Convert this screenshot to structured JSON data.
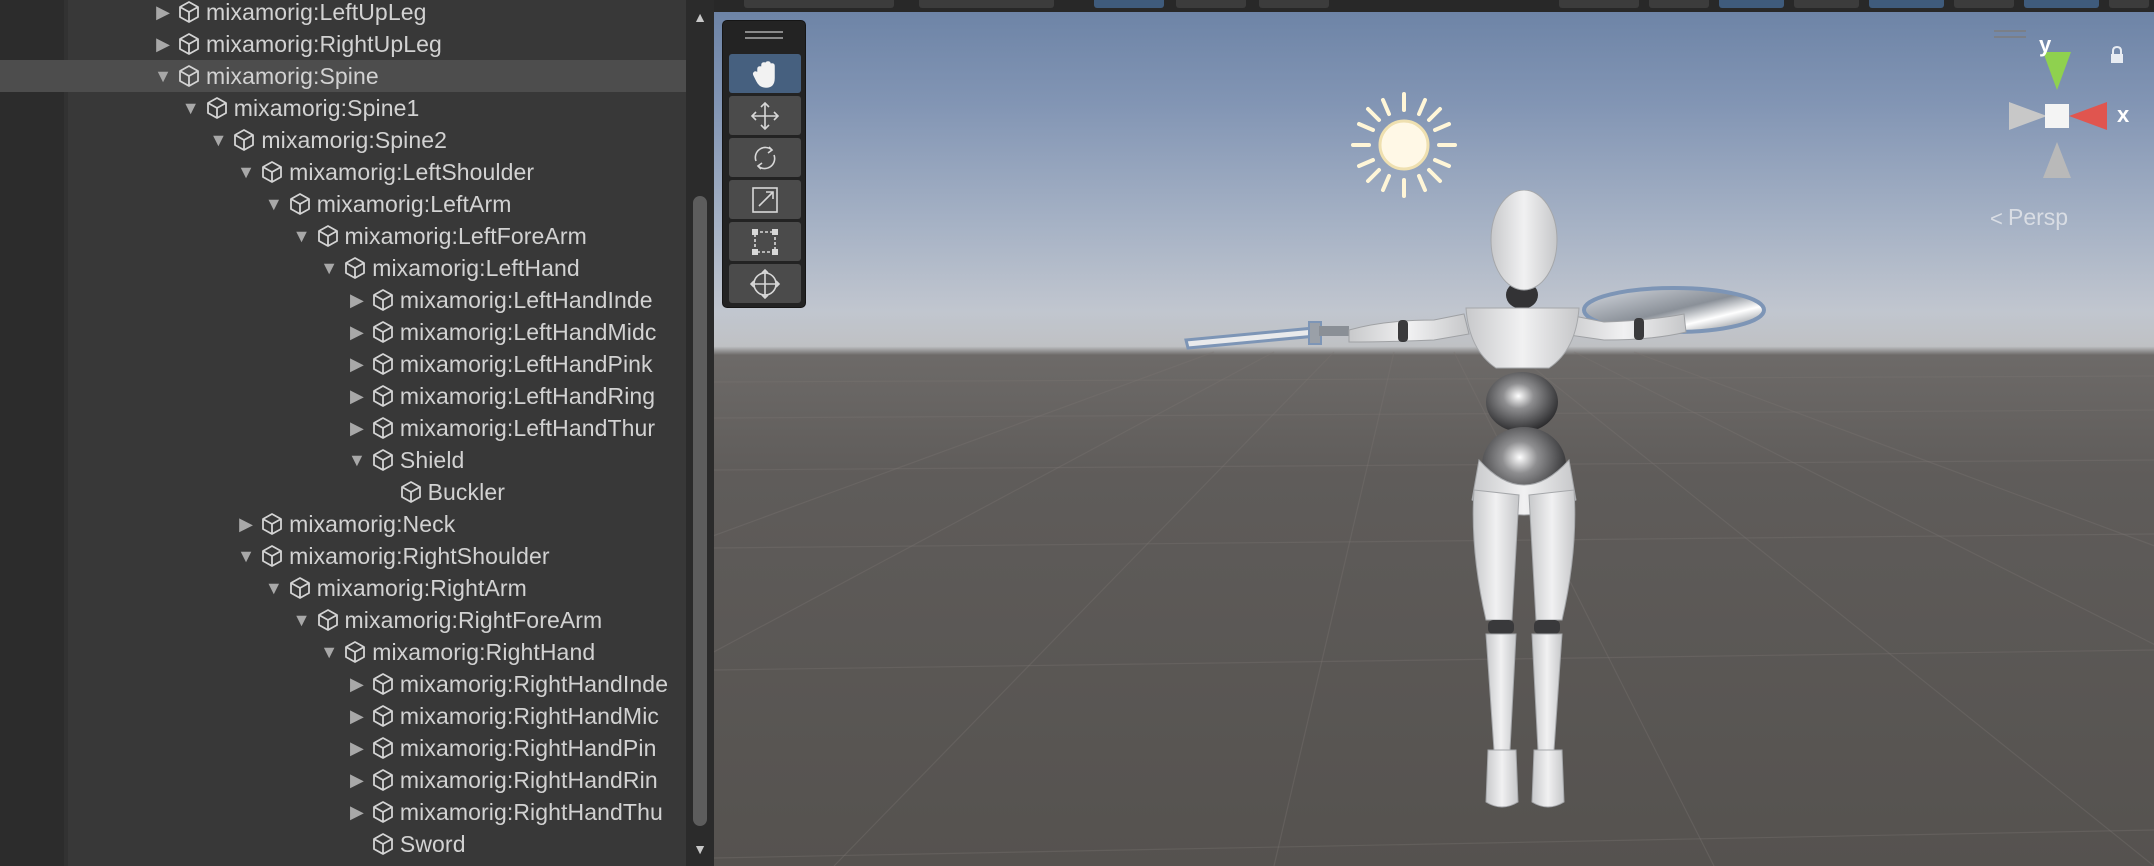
{
  "hierarchy": {
    "items": [
      {
        "label": "mixamorig:LeftUpLeg",
        "depth": 0,
        "arrow": "collapsed",
        "selected": false
      },
      {
        "label": "mixamorig:RightUpLeg",
        "depth": 0,
        "arrow": "collapsed",
        "selected": false
      },
      {
        "label": "mixamorig:Spine",
        "depth": 0,
        "arrow": "expanded",
        "selected": true
      },
      {
        "label": "mixamorig:Spine1",
        "depth": 1,
        "arrow": "expanded",
        "selected": false
      },
      {
        "label": "mixamorig:Spine2",
        "depth": 2,
        "arrow": "expanded",
        "selected": false
      },
      {
        "label": "mixamorig:LeftShoulder",
        "depth": 3,
        "arrow": "expanded",
        "selected": false
      },
      {
        "label": "mixamorig:LeftArm",
        "depth": 4,
        "arrow": "expanded",
        "selected": false
      },
      {
        "label": "mixamorig:LeftForeArm",
        "depth": 5,
        "arrow": "expanded",
        "selected": false
      },
      {
        "label": "mixamorig:LeftHand",
        "depth": 6,
        "arrow": "expanded",
        "selected": false
      },
      {
        "label": "mixamorig:LeftHandInde",
        "depth": 7,
        "arrow": "collapsed",
        "selected": false
      },
      {
        "label": "mixamorig:LeftHandMidc",
        "depth": 7,
        "arrow": "collapsed",
        "selected": false
      },
      {
        "label": "mixamorig:LeftHandPink",
        "depth": 7,
        "arrow": "collapsed",
        "selected": false
      },
      {
        "label": "mixamorig:LeftHandRing",
        "depth": 7,
        "arrow": "collapsed",
        "selected": false
      },
      {
        "label": "mixamorig:LeftHandThur",
        "depth": 7,
        "arrow": "collapsed",
        "selected": false
      },
      {
        "label": "Shield",
        "depth": 7,
        "arrow": "expanded",
        "selected": false
      },
      {
        "label": "Buckler",
        "depth": 8,
        "arrow": "none",
        "selected": false
      },
      {
        "label": "mixamorig:Neck",
        "depth": 3,
        "arrow": "collapsed",
        "selected": false
      },
      {
        "label": "mixamorig:RightShoulder",
        "depth": 3,
        "arrow": "expanded",
        "selected": false
      },
      {
        "label": "mixamorig:RightArm",
        "depth": 4,
        "arrow": "expanded",
        "selected": false
      },
      {
        "label": "mixamorig:RightForeArm",
        "depth": 5,
        "arrow": "expanded",
        "selected": false
      },
      {
        "label": "mixamorig:RightHand",
        "depth": 6,
        "arrow": "expanded",
        "selected": false
      },
      {
        "label": "mixamorig:RightHandInde",
        "depth": 7,
        "arrow": "collapsed",
        "selected": false
      },
      {
        "label": "mixamorig:RightHandMic",
        "depth": 7,
        "arrow": "collapsed",
        "selected": false
      },
      {
        "label": "mixamorig:RightHandPin",
        "depth": 7,
        "arrow": "collapsed",
        "selected": false
      },
      {
        "label": "mixamorig:RightHandRin",
        "depth": 7,
        "arrow": "collapsed",
        "selected": false
      },
      {
        "label": "mixamorig:RightHandThu",
        "depth": 7,
        "arrow": "collapsed",
        "selected": false
      },
      {
        "label": "Sword",
        "depth": 7,
        "arrow": "none",
        "selected": false
      }
    ],
    "icon": "gameobject-cube-icon"
  },
  "scene": {
    "tools": [
      {
        "name": "hand-tool",
        "active": true
      },
      {
        "name": "move-tool",
        "active": false
      },
      {
        "name": "rotate-tool",
        "active": false
      },
      {
        "name": "scale-tool",
        "active": false
      },
      {
        "name": "rect-tool",
        "active": false
      },
      {
        "name": "transform-tool",
        "active": false
      }
    ],
    "gizmo": {
      "x_label": "x",
      "y_label": "y",
      "projection_label": "Persp"
    },
    "colors": {
      "selection": "#4d4d4d",
      "active_tool": "#46607f",
      "axis_x": "#e0554f",
      "axis_y": "#8fd14f"
    }
  }
}
